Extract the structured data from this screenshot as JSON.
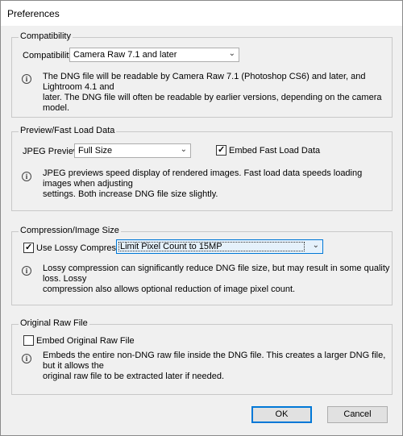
{
  "window": {
    "title": "Preferences"
  },
  "compatibility": {
    "group_label": "Compatibility",
    "field_label": "Compatibility:",
    "selected": "Camera Raw 7.1 and later",
    "info_line1": "The DNG file will be readable by Camera Raw 7.1 (Photoshop CS6) and later, and Lightroom 4.1 and",
    "info_line2": "later. The DNG file will often be readable by earlier versions, depending on the camera model."
  },
  "preview": {
    "group_label": "Preview/Fast Load Data",
    "jpeg_label": "JPEG Preview:",
    "jpeg_selected": "Full Size",
    "embed_fast_label": "Embed Fast Load Data",
    "embed_fast_checked": true,
    "info_line1": "JPEG previews speed display of rendered images.  Fast load data speeds loading images when adjusting",
    "info_line2": "settings.  Both increase DNG file size slightly."
  },
  "compression": {
    "group_label": "Compression/Image Size",
    "lossy_label": "Use Lossy Compression:",
    "lossy_checked": true,
    "lossy_selected": "Limit Pixel Count to 15MP",
    "info_line1": "Lossy compression can significantly reduce DNG file size, but may result in some quality loss.  Lossy",
    "info_line2": "compression also allows optional reduction of image pixel count."
  },
  "original": {
    "group_label": "Original Raw File",
    "embed_label": "Embed Original Raw File",
    "embed_checked": false,
    "info_line1": "Embeds the entire non-DNG raw file inside the DNG file.  This creates a larger DNG file, but it allows the",
    "info_line2": "original raw file to be extracted later if needed."
  },
  "buttons": {
    "ok": "OK",
    "cancel": "Cancel"
  },
  "colors": {
    "accent": "#0078d7",
    "dialog_bg": "#f0f0f0"
  }
}
